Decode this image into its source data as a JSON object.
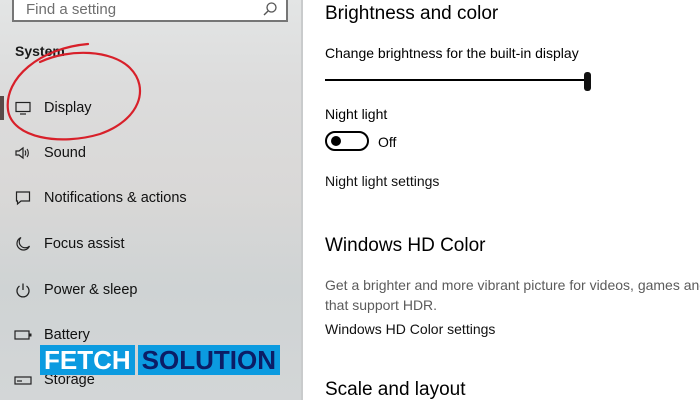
{
  "search": {
    "placeholder": "Find a setting"
  },
  "sidebar": {
    "section": "System",
    "items": [
      {
        "label": "Display",
        "icon": "monitor-icon"
      },
      {
        "label": "Sound",
        "icon": "speaker-icon"
      },
      {
        "label": "Notifications & actions",
        "icon": "notification-icon"
      },
      {
        "label": "Focus assist",
        "icon": "moon-icon"
      },
      {
        "label": "Power & sleep",
        "icon": "power-icon"
      },
      {
        "label": "Battery",
        "icon": "battery-icon"
      },
      {
        "label": "Storage",
        "icon": "storage-icon"
      }
    ],
    "active_index": 0
  },
  "watermark": {
    "part1": "FETCH",
    "part2": "SOLUTION"
  },
  "main": {
    "brightness": {
      "title": "Brightness and color",
      "slider_label": "Change brightness for the built-in display",
      "slider_value": 1.0
    },
    "night_light": {
      "label": "Night light",
      "state": "Off",
      "settings_link": "Night light settings"
    },
    "hd_color": {
      "title": "Windows HD Color",
      "desc_line1": "Get a brighter and more vibrant picture for videos, games and apps",
      "desc_line2": "that support HDR.",
      "settings_link": "Windows HD Color settings"
    },
    "scale": {
      "title": "Scale and layout"
    }
  },
  "colors": {
    "accent": "#0b9be0",
    "annotation": "#d8202a"
  }
}
